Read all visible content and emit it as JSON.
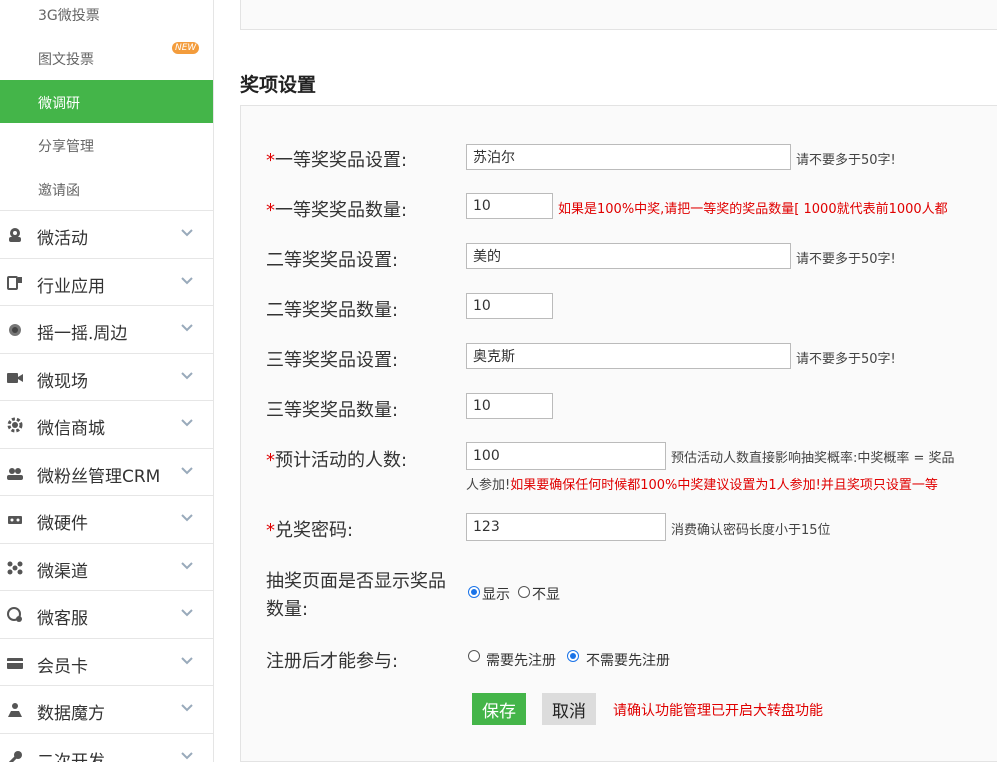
{
  "sidebar": {
    "sub_items": [
      {
        "label": "3G微投票"
      },
      {
        "label": "图文投票",
        "badge": "NEW"
      },
      {
        "label": "微调研",
        "active": true
      },
      {
        "label": "分享管理"
      },
      {
        "label": "邀请函"
      }
    ],
    "nav_items": [
      {
        "label": "微活动",
        "icon": "activity-icon"
      },
      {
        "label": "行业应用",
        "icon": "industry-app-icon"
      },
      {
        "label": "摇一摇.周边",
        "icon": "shake-icon"
      },
      {
        "label": "微现场",
        "icon": "video-camera-icon"
      },
      {
        "label": "微信商城",
        "icon": "gear-icon"
      },
      {
        "label": "微粉丝管理CRM",
        "icon": "users-icon"
      },
      {
        "label": "微硬件",
        "icon": "hardware-icon"
      },
      {
        "label": "微渠道",
        "icon": "channel-icon"
      },
      {
        "label": "微客服",
        "icon": "customer-service-icon"
      },
      {
        "label": "会员卡",
        "icon": "card-icon"
      },
      {
        "label": "数据魔方",
        "icon": "data-cube-icon"
      },
      {
        "label": "二次开发",
        "icon": "wrench-icon"
      }
    ]
  },
  "main": {
    "section_title": "奖项设置",
    "form": {
      "first_prize_name": {
        "label": "一等奖奖品设置:",
        "required": "*",
        "value": "苏泊尔",
        "hint": "请不要多于50字!"
      },
      "first_prize_qty": {
        "label": "一等奖奖品数量:",
        "required": "*",
        "value": "10",
        "hint": "如果是100%中奖,请把一等奖的奖品数量[ 1000就代表前1000人都"
      },
      "second_prize_name": {
        "label": "二等奖奖品设置:",
        "value": "美的",
        "hint": "请不要多于50字!"
      },
      "second_prize_qty": {
        "label": "二等奖奖品数量:",
        "value": "10"
      },
      "third_prize_name": {
        "label": "三等奖奖品设置:",
        "value": "奥克斯",
        "hint": "请不要多于50字!"
      },
      "third_prize_qty": {
        "label": "三等奖奖品数量:",
        "value": "10"
      },
      "expected_people": {
        "label": "预计活动的人数:",
        "required": "*",
        "value": "100",
        "hint": "预估活动人数直接影响抽奖概率:中奖概率 = 奖品",
        "hint2_plain": "人参加!",
        "hint2_red": "如果要确保任何时候都100%中奖建议设置为1人参加!并且奖项只设置一等"
      },
      "redeem_password": {
        "label": "兑奖密码:",
        "required": "*",
        "value": "123",
        "hint": "消费确认密码长度小于15位"
      },
      "show_prize_qty": {
        "label_line1": "抽奖页面是否显示奖品",
        "label_line2": "数量:",
        "option_show": "显示",
        "option_hide": "不显"
      },
      "register_required": {
        "label": "注册后才能参与:",
        "option_need": "需要先注册",
        "option_no_need": "不需要先注册"
      },
      "save_label": "保存",
      "cancel_label": "取消",
      "footer_note": "请确认功能管理已开启大转盘功能"
    }
  }
}
